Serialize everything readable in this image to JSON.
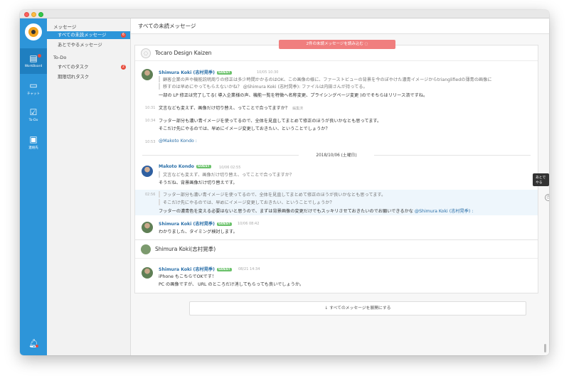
{
  "rail": {
    "items": [
      {
        "label": "WorkBoard",
        "icon": "workboard-icon"
      },
      {
        "label": "チャット",
        "icon": "chat-icon"
      },
      {
        "label": "To-Do",
        "icon": "todo-icon"
      },
      {
        "label": "連絡先",
        "icon": "contacts-icon"
      }
    ],
    "bell_icon": "bell-icon"
  },
  "sidebar": {
    "messages_section": "メッセージ",
    "unread_item": "すべての未読メッセージ",
    "unread_count": "6",
    "later_item": "あとでやるメッセージ",
    "todo_section": "To-Do",
    "all_tasks_item": "すべてのタスク",
    "all_tasks_count": "2",
    "expired_item": "期限切れタスク"
  },
  "main": {
    "title": "すべての未読メッセージ",
    "load_banner": "2件の未読メッセージを読み込む ◌",
    "later_tooltip": "あとでやる",
    "expand_button": "↓ すべてのメッセージを展開にする"
  },
  "room1": {
    "name": "Tocaro Design Kaizen",
    "msg1": {
      "author": "Shimura Koki (志村晃季)",
      "badge": "GUEST",
      "time": "10/05 10:30",
      "quote1": "顧客企業の声や機能説明周りの修正は多少時間かかるのはOK、この画像の様に、ファーストビューの背景を今のぼやけた濃青イメージからtrianglifiedの薄青の画像に",
      "quote2": "移すのは早めにやってもらえないかね？ @Shimura Koki (志村晃季): ファイルは内田さんが持ってる。",
      "body": "一部の LP 修正は完了してる( 導入企業様の声、機能一覧を特徴へ名称変更、プライシングページ変更 )のでそちらはリリース済ですね。"
    },
    "line2": {
      "time": "10:31",
      "text": "文言なども変えず、画像だけ切り替え、ってことで合ってますか？",
      "edited": "編集済"
    },
    "line3": {
      "time": "10:34",
      "text1": "フッター部分も濃い青イメージを使ってるので、全体を見直してまとめて修正のほうが良いかなとも思ってます。",
      "text2": "そこだけ先にやるのでは、早めにイメージ変更しておきたい、ということでしょうか？"
    },
    "line4": {
      "time": "10:53",
      "mention": "@Makoto Kondo :"
    },
    "date_separator": "2018/10/06 (土曜日)",
    "msg2": {
      "author": "Makoto Kondo",
      "badge": "GUEST",
      "time": "10/06 02:55",
      "quote": "文言なども変えず、画像だけ切り替え、ってことで合ってますか？",
      "body": "そうだね、背景画像だけ切り替えです。"
    },
    "line5": {
      "time": "02:56",
      "quote1": "フッター部分も濃い青イメージを使ってるので、全体を見直してまとめて修正のほうが良いかなとも思ってます。",
      "quote2": "そこだけ先にやるのでは、早めにイメージ変更しておきたい、ということでしょうか？",
      "body": "フッターの濃青色を変える必要はないと思うので、まずは背景画像の変更だけでもスッキリさせておきたいのでお願いできるかな",
      "mention": "@Shimura Koki (志村晃季) :"
    },
    "msg3": {
      "author": "Shimura Koki (志村晃季)",
      "badge": "GUEST",
      "time": "10/06 08:42",
      "body": "わかりました、タイミング検討します。"
    }
  },
  "room2": {
    "name": "Shimura Koki(志村晃季)",
    "msg1": {
      "author": "Shimura Koki (志村晃季)",
      "badge": "GUEST",
      "time": "08/21 14:34",
      "body1": "iPhone もこちらでOKです！",
      "body2": "PC の画像ですが、 URL のところだけ消してもらっても良いでしょうか。"
    }
  }
}
